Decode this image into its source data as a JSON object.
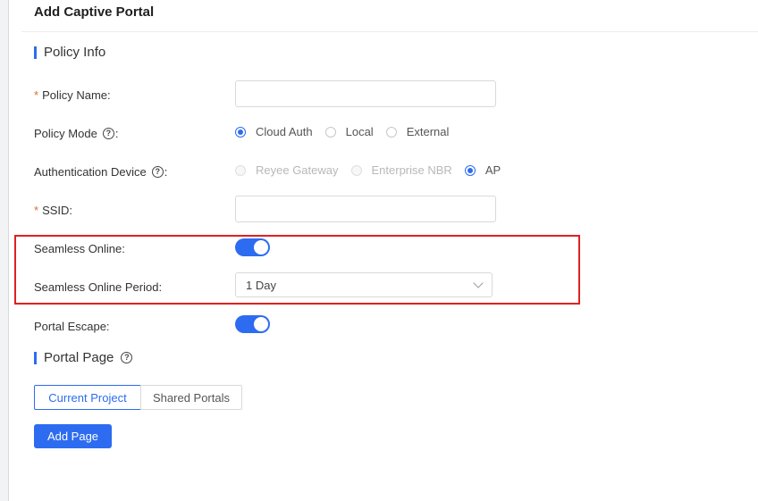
{
  "header": {
    "title": "Add Captive Portal"
  },
  "policy_info": {
    "title": "Policy Info",
    "policy_name": {
      "label": "Policy Name:",
      "value": "",
      "placeholder": ""
    },
    "policy_mode": {
      "label": "Policy Mode",
      "suffix": ":",
      "options": [
        "Cloud Auth",
        "Local",
        "External"
      ],
      "selected": "Cloud Auth"
    },
    "auth_device": {
      "label": "Authentication Device",
      "suffix": ":",
      "options": [
        "Reyee Gateway",
        "Enterprise NBR",
        "AP"
      ],
      "selected": "AP"
    },
    "ssid": {
      "label": "SSID:",
      "value": "",
      "placeholder": ""
    },
    "seamless_online": {
      "label": "Seamless Online:",
      "enabled": true
    },
    "seamless_online_period": {
      "label": "Seamless Online Period:",
      "value": "1 Day"
    },
    "portal_escape": {
      "label": "Portal Escape:",
      "enabled": true
    }
  },
  "portal_page": {
    "title": "Portal Page",
    "tabs": [
      "Current Project",
      "Shared Portals"
    ],
    "active_tab": "Current Project",
    "add_button": "Add Page"
  },
  "colors": {
    "accent": "#2d6cf0",
    "highlight": "#e02020",
    "required": "#e26b2d"
  },
  "icons": {
    "help": "question-circle-icon",
    "select_arrow": "chevron-down-icon"
  }
}
